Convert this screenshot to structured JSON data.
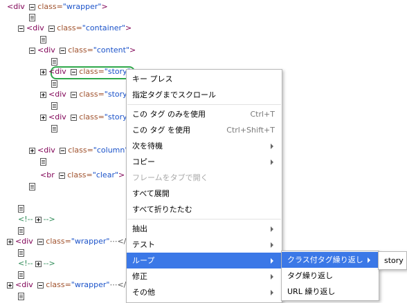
{
  "tree": {
    "div": "<div",
    "br": "<br",
    "class_attr": "class=",
    "gt": ">",
    "comment_open": "<!--",
    "comment_close": "-->",
    "ellipsis": "⋯</",
    "wrapper": "\"wrapper\"",
    "container": "\"container\"",
    "content": "\"content\"",
    "story": "\"story\"",
    "column": "\"column\"",
    "clear": "\"clear\""
  },
  "menu": {
    "items": [
      {
        "label": "キー プレス"
      },
      {
        "label": "指定タグまでスクロール"
      },
      {
        "label": "この タグ のみを使用",
        "shortcut": "Ctrl+T"
      },
      {
        "label": "この タグ を使用",
        "shortcut": "Ctrl+Shift+T"
      },
      {
        "label": "次を待機"
      },
      {
        "label": "コピー"
      },
      {
        "label": "フレームをタブで開く"
      },
      {
        "label": "すべて展開"
      },
      {
        "label": "すべて折りたたむ"
      },
      {
        "label": "抽出"
      },
      {
        "label": "テスト"
      },
      {
        "label": "ループ"
      },
      {
        "label": "修正"
      },
      {
        "label": "その他"
      }
    ]
  },
  "submenu": {
    "items": [
      {
        "label": "クラス付タグ繰り返し"
      },
      {
        "label": "タグ繰り返し"
      },
      {
        "label": "URL 繰り返し"
      }
    ]
  },
  "subsubmenu": {
    "items": [
      {
        "label": "story"
      }
    ]
  },
  "colors": {
    "tag": "#7f0055",
    "attr": "#a0522d",
    "value": "#1a52c9",
    "comment": "#2e8b57",
    "highlight_border": "#2ea84a",
    "menu_active": "#3b78e7"
  }
}
